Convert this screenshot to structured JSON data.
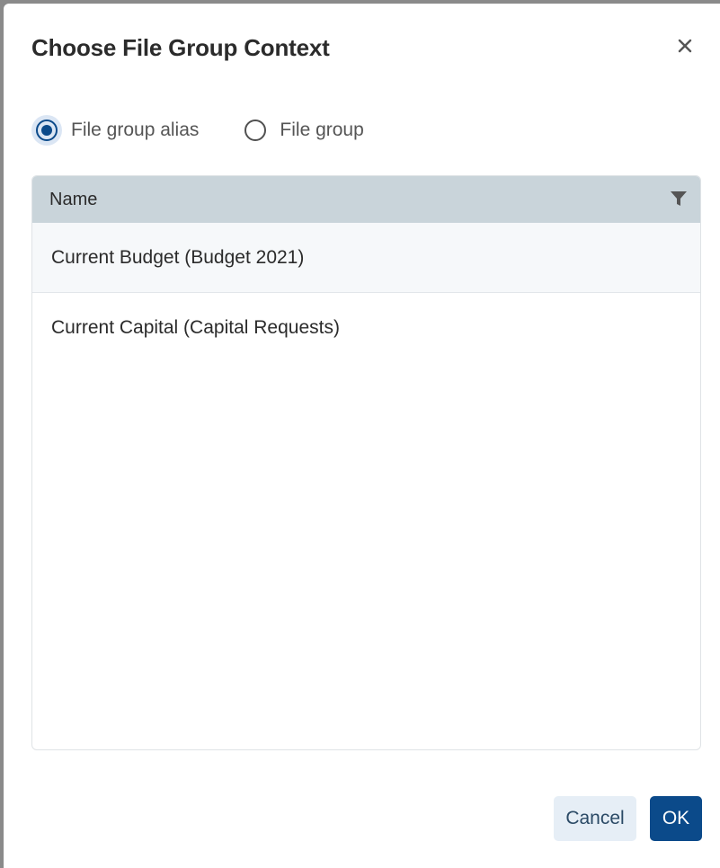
{
  "dialog": {
    "title": "Choose File Group Context"
  },
  "radios": [
    {
      "label": "File group alias",
      "checked": true
    },
    {
      "label": "File group",
      "checked": false
    }
  ],
  "grid": {
    "column_header": "Name",
    "rows": [
      {
        "name": "Current Budget (Budget 2021)",
        "selected": true
      },
      {
        "name": "Current Capital (Capital Requests)",
        "selected": false
      }
    ]
  },
  "footer": {
    "cancel_label": "Cancel",
    "ok_label": "OK"
  },
  "icons": {
    "close": "close-icon",
    "filter": "filter-icon"
  },
  "colors": {
    "accent": "#0b4a8a",
    "grid_header_bg": "#c9d4da",
    "cancel_bg": "#e6eef6"
  }
}
